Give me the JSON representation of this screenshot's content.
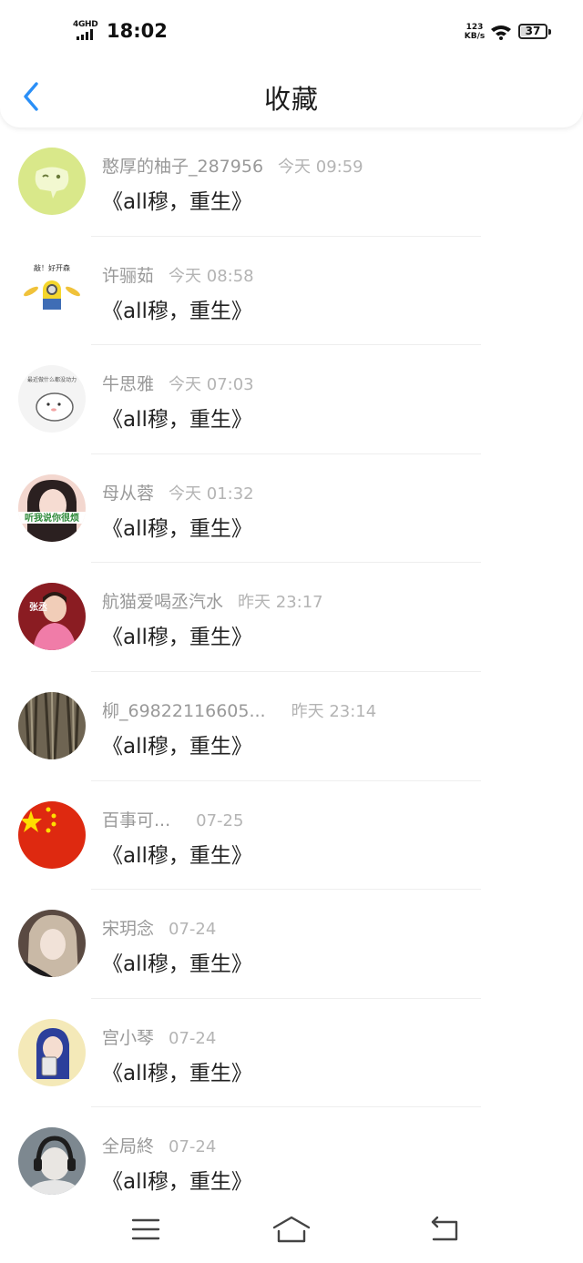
{
  "status": {
    "network": "4GHD",
    "time": "18:02",
    "speed_value": "123",
    "speed_unit": "KB/s",
    "battery": "37",
    "battery_level": 0.37
  },
  "header": {
    "title": "收藏",
    "accent": "#2a8ff7"
  },
  "items": [
    {
      "name": "憨厚的柚子_287956",
      "time": "今天 09:59",
      "title": "《all穆，重生》",
      "avatar": "wechat-default-avatar"
    },
    {
      "name": "许骊茹",
      "time": "今天 08:58",
      "title": "《all穆，重生》",
      "avatar": "minion-avatar",
      "avatar_text": "敲！好开森"
    },
    {
      "name": "牛思雅",
      "time": "今天 07:03",
      "title": "《all穆，重生》",
      "avatar": "hamster-cartoon-avatar",
      "avatar_text": "最近做什么都没动力"
    },
    {
      "name": "母从蓉",
      "time": "今天 01:32",
      "title": "《all穆，重生》",
      "avatar": "girl-photo-avatar",
      "avatar_text": "听我说你很烦"
    },
    {
      "name": "航猫爱喝丞汽水",
      "time": "昨天 23:17",
      "title": "《all穆，重生》",
      "avatar": "boy-poster-avatar",
      "avatar_text": "张丞"
    },
    {
      "name": "柳_69822116605...",
      "time": "昨天 23:14",
      "title": "《all穆，重生》",
      "avatar": "tree-bark-avatar"
    },
    {
      "name": "百事可...",
      "time": "07-25",
      "title": "《all穆，重生》",
      "avatar": "china-flag-avatar"
    },
    {
      "name": "宋玥念",
      "time": "07-24",
      "title": "《all穆，重生》",
      "avatar": "portrait-photo-avatar"
    },
    {
      "name": "宫小琴",
      "time": "07-24",
      "title": "《all穆，重生》",
      "avatar": "blue-hair-girl-avatar"
    },
    {
      "name": "全局終",
      "time": "07-24",
      "title": "《all穆，重生》",
      "avatar": "headphones-boy-avatar"
    }
  ],
  "bottom_nav": {
    "menu_icon": "menu-icon",
    "home_icon": "home-icon",
    "back_icon": "back-return-icon"
  }
}
